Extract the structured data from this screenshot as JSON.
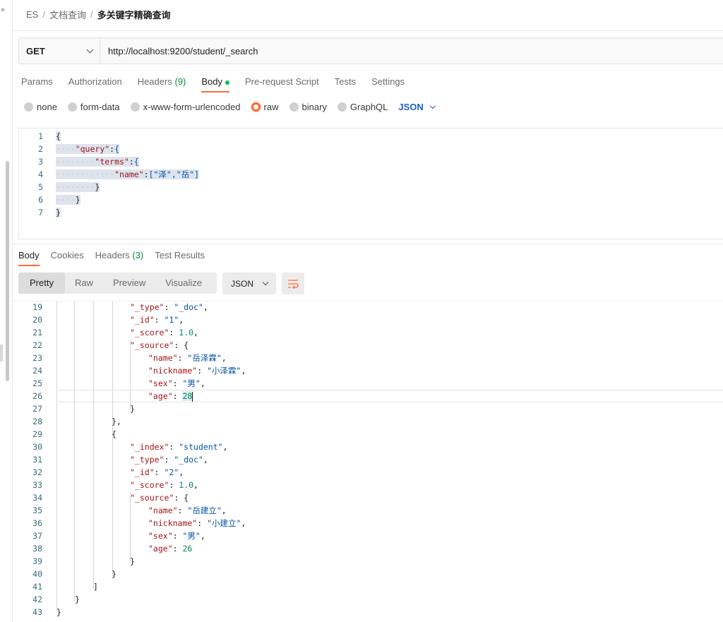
{
  "breadcrumb": {
    "root": "ES",
    "folder": "文档查询",
    "current": "多关键字精确查询",
    "sep": "/"
  },
  "request": {
    "method": "GET",
    "url": "http://localhost:9200/student/_search",
    "tabs": [
      {
        "label": "Params",
        "count": ""
      },
      {
        "label": "Authorization",
        "count": ""
      },
      {
        "label": "Headers",
        "count": "(9)"
      },
      {
        "label": "Body",
        "count": ""
      },
      {
        "label": "Pre-request Script",
        "count": ""
      },
      {
        "label": "Tests",
        "count": ""
      },
      {
        "label": "Settings",
        "count": ""
      }
    ],
    "active_tab": "Body",
    "body_types": [
      "none",
      "form-data",
      "x-www-form-urlencoded",
      "raw",
      "binary",
      "GraphQL"
    ],
    "body_type_selected": "raw",
    "language": "JSON",
    "body_lines": [
      {
        "n": "1",
        "text": "{"
      },
      {
        "n": "2",
        "text": "\"query\":{"
      },
      {
        "n": "3",
        "text": "\"terms\":{"
      },
      {
        "n": "4",
        "text": "\"name\":[\"泽\",\"岳\"]"
      },
      {
        "n": "5",
        "text": "}"
      },
      {
        "n": "6",
        "text": "}"
      },
      {
        "n": "7",
        "text": "}"
      }
    ]
  },
  "response": {
    "tabs": [
      {
        "label": "Body",
        "count": ""
      },
      {
        "label": "Cookies",
        "count": ""
      },
      {
        "label": "Headers",
        "count": "(3)"
      },
      {
        "label": "Test Results",
        "count": ""
      }
    ],
    "views": [
      "Pretty",
      "Raw",
      "Preview",
      "Visualize"
    ],
    "active_view": "Pretty",
    "format": "JSON",
    "lines": [
      {
        "n": "19",
        "key": "\"_type\"",
        "val": "\"_doc\"",
        "tail": ","
      },
      {
        "n": "20",
        "key": "\"_id\"",
        "val": "\"1\"",
        "tail": ","
      },
      {
        "n": "21",
        "key": "\"_score\"",
        "val": "1.0",
        "tail": ","
      },
      {
        "n": "22",
        "key": "\"_source\"",
        "val": "{",
        "tail": ""
      },
      {
        "n": "23",
        "key": "\"name\"",
        "val": "\"岳泽霖\"",
        "tail": ","
      },
      {
        "n": "24",
        "key": "\"nickname\"",
        "val": "\"小泽霖\"",
        "tail": ","
      },
      {
        "n": "25",
        "key": "\"sex\"",
        "val": "\"男\"",
        "tail": ","
      },
      {
        "n": "26",
        "key": "\"age\"",
        "val": "28",
        "tail": ""
      },
      {
        "n": "27",
        "key": "",
        "val": "}",
        "tail": ""
      },
      {
        "n": "28",
        "key": "",
        "val": "},",
        "tail": ""
      },
      {
        "n": "29",
        "key": "",
        "val": "{",
        "tail": ""
      },
      {
        "n": "30",
        "key": "\"_index\"",
        "val": "\"student\"",
        "tail": ","
      },
      {
        "n": "31",
        "key": "\"_type\"",
        "val": "\"_doc\"",
        "tail": ","
      },
      {
        "n": "32",
        "key": "\"_id\"",
        "val": "\"2\"",
        "tail": ","
      },
      {
        "n": "33",
        "key": "\"_score\"",
        "val": "1.0",
        "tail": ","
      },
      {
        "n": "34",
        "key": "\"_source\"",
        "val": "{",
        "tail": ""
      },
      {
        "n": "35",
        "key": "\"name\"",
        "val": "\"岳建立\"",
        "tail": ","
      },
      {
        "n": "36",
        "key": "\"nickname\"",
        "val": "\"小建立\"",
        "tail": ","
      },
      {
        "n": "37",
        "key": "\"sex\"",
        "val": "\"男\"",
        "tail": ","
      },
      {
        "n": "38",
        "key": "\"age\"",
        "val": "26",
        "tail": ""
      },
      {
        "n": "39",
        "key": "",
        "val": "}",
        "tail": ""
      },
      {
        "n": "40",
        "key": "",
        "val": "}",
        "tail": ""
      },
      {
        "n": "41",
        "key": "",
        "val": "]",
        "tail": ""
      },
      {
        "n": "42",
        "key": "",
        "val": "}",
        "tail": ""
      },
      {
        "n": "43",
        "key": "",
        "val": "}",
        "tail": ""
      }
    ]
  },
  "colors": {
    "accent": "#ff6c37",
    "link": "#1a5fcc",
    "count": "#0b8a3e",
    "key": "#a31515",
    "string": "#0451a5",
    "number": "#098658"
  }
}
